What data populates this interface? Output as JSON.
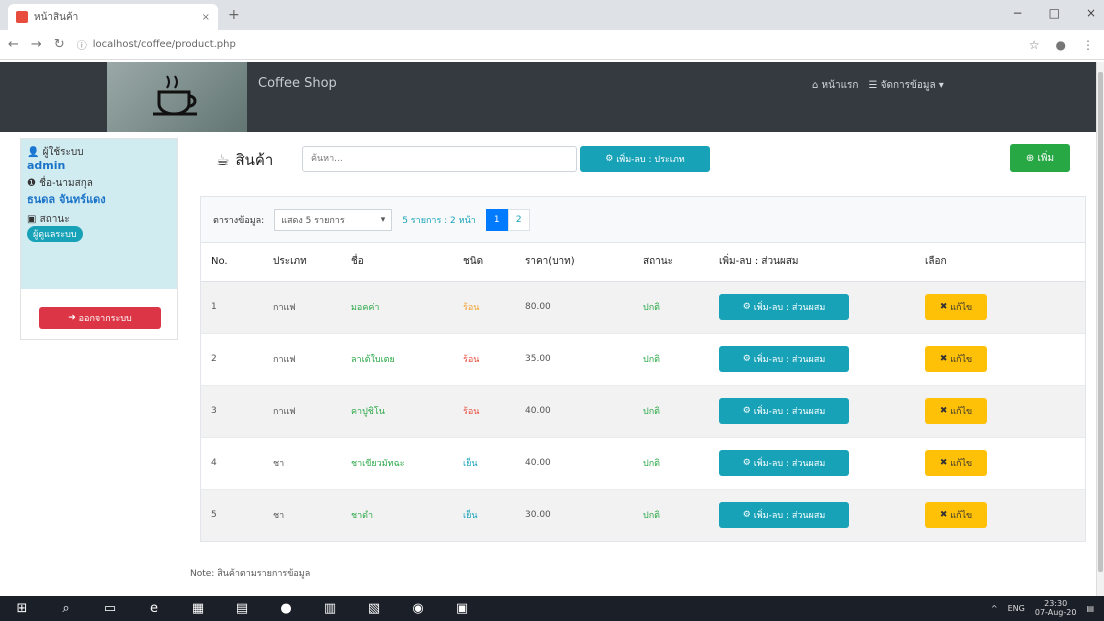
{
  "browser": {
    "tab_title": "หน้าสินค้า",
    "tab_close": "×",
    "new_tab": "+",
    "url": "localhost/coffee/product.php",
    "controls": [
      "−",
      "□",
      "×"
    ]
  },
  "navbar": {
    "brand": "Coffee Shop",
    "home": "หน้าแรก",
    "manage": "จัดการข้อมูล ▾"
  },
  "sidebar": {
    "user_label": "ผู้ใช้ระบบ",
    "user_value": "admin",
    "name_label": "ชื่อ-นามสกุล",
    "name_value": "ธนดล จันทร์แดง",
    "status_label": "สถานะ",
    "status_value": "ผู้ดูแลระบบ",
    "logout": "ออกจากระบบ"
  },
  "main": {
    "title": "สินค้า",
    "search_placeholder": "ค้นหา...",
    "type_button": "เพิ่ม-ลบ : ประเภท",
    "add_button": "เพิ่ม"
  },
  "toolbar": {
    "label": "ตารางข้อมูล:",
    "select_value": "แสดง 5 รายการ",
    "page_info": "5 รายการ : 2 หน้า",
    "pages": [
      "1",
      "2"
    ]
  },
  "table": {
    "headers": [
      "No.",
      "ประเภท",
      "ชื่อ",
      "ชนิด",
      "ราคา(บาท)",
      "สถานะ",
      "เพิ่ม-ลบ : ส่วนผสม",
      "เลือก"
    ],
    "rows": [
      {
        "no": "1",
        "type": "กาแฟ",
        "name": "มอคค่า",
        "kind": "ร้อน",
        "price": "80.00",
        "status": "ปกติ"
      },
      {
        "no": "2",
        "type": "กาแฟ",
        "name": "ลาเต้ใบเตย",
        "kind": "ร้อน",
        "price": "35.00",
        "status": "ปกติ"
      },
      {
        "no": "3",
        "type": "กาแฟ",
        "name": "คาปูชิโน",
        "kind": "ร้อน",
        "price": "40.00",
        "status": "ปกติ"
      },
      {
        "no": "4",
        "type": "ชา",
        "name": "ชาเขียวมัทฉะ",
        "kind": "เย็น",
        "price": "40.00",
        "status": "ปกติ"
      },
      {
        "no": "5",
        "type": "ชา",
        "name": "ชาดำ",
        "kind": "เย็น",
        "price": "30.00",
        "status": "ปกติ"
      }
    ],
    "row_button": "เพิ่ม-ลบ : ส่วนผสม",
    "edit_button": "แก้ไข"
  },
  "note": "Note: สินค้าตามรายการข้อมูล",
  "taskbar": {
    "clock_time": "23:30",
    "clock_date": "07-Aug-20",
    "lang": "ENG"
  }
}
